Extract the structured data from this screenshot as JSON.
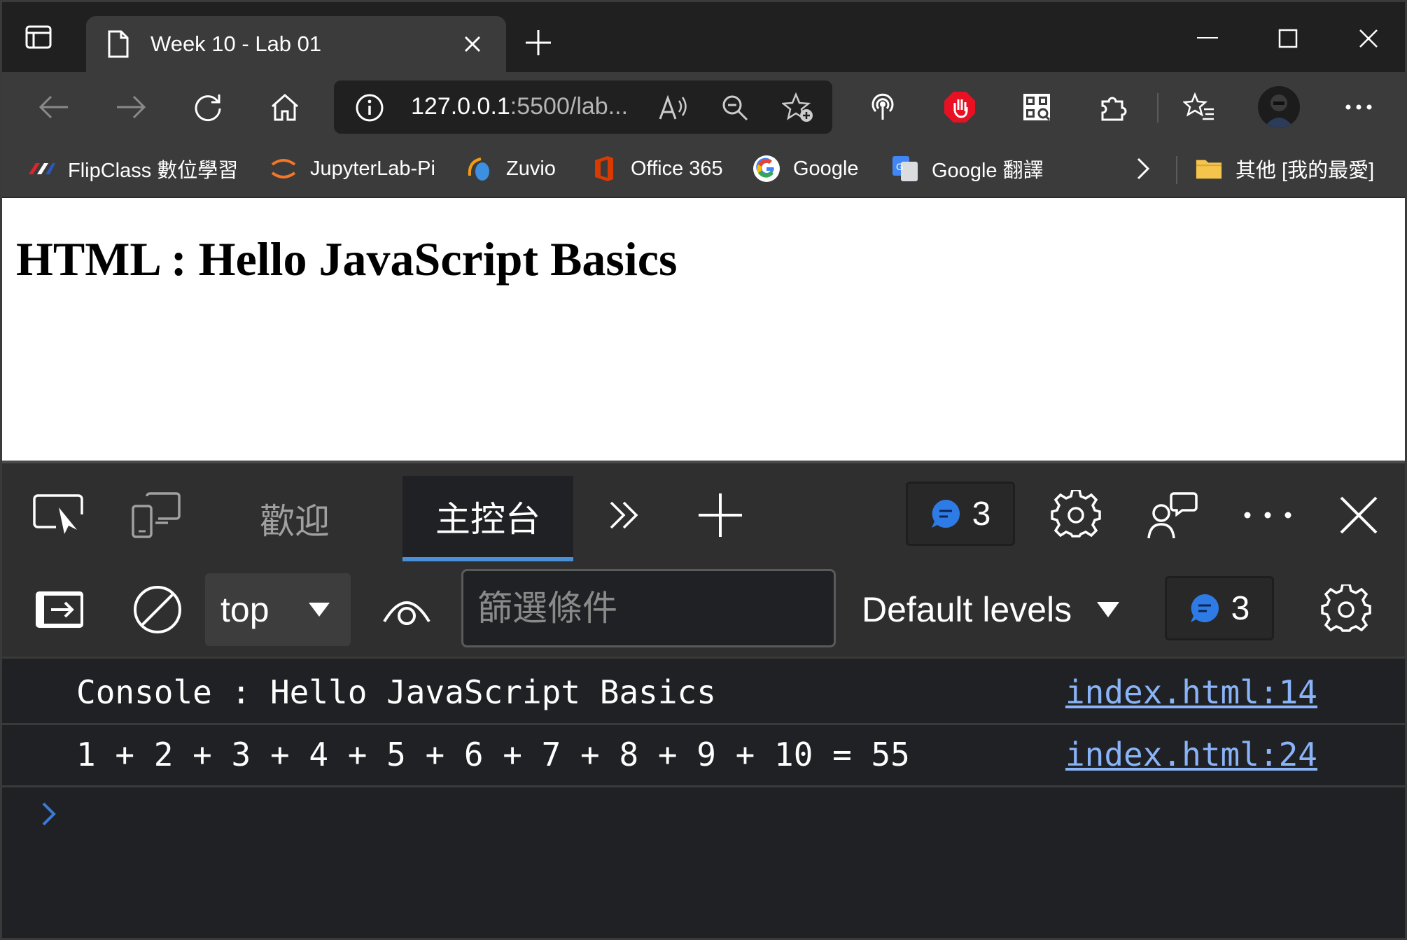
{
  "browser": {
    "tab_title": "Week 10 - Lab 01",
    "address": {
      "host": "127.0.0.1",
      "rest": ":5500/lab..."
    },
    "bookmarks": [
      {
        "label": "FlipClass 數位學習",
        "icon": "flipclass-icon"
      },
      {
        "label": "JupyterLab-Pi",
        "icon": "jupyter-icon"
      },
      {
        "label": "Zuvio",
        "icon": "zuvio-icon"
      },
      {
        "label": "Office 365",
        "icon": "office-icon"
      },
      {
        "label": "Google",
        "icon": "google-icon"
      },
      {
        "label": "Google 翻譯",
        "icon": "google-translate-icon"
      }
    ],
    "other_favorites": "其他 [我的最愛]"
  },
  "page": {
    "heading": "HTML : Hello JavaScript Basics"
  },
  "devtools": {
    "tabs": {
      "welcome": "歡迎",
      "console": "主控台"
    },
    "issues_count": "3",
    "console_toolbar": {
      "context": "top",
      "filter_placeholder": "篩選條件",
      "levels": "Default levels",
      "issues_count": "3"
    },
    "messages": [
      {
        "text": "Console : Hello JavaScript Basics",
        "source": "index.html:14"
      },
      {
        "text": "1 + 2 + 3 + 4 + 5 + 6 + 7 + 8 + 9 + 10 = 55",
        "source": "index.html:24"
      }
    ]
  },
  "colors": {
    "accent": "#4a90d9",
    "link": "#8ab4f8",
    "stop_red": "#e81123"
  }
}
